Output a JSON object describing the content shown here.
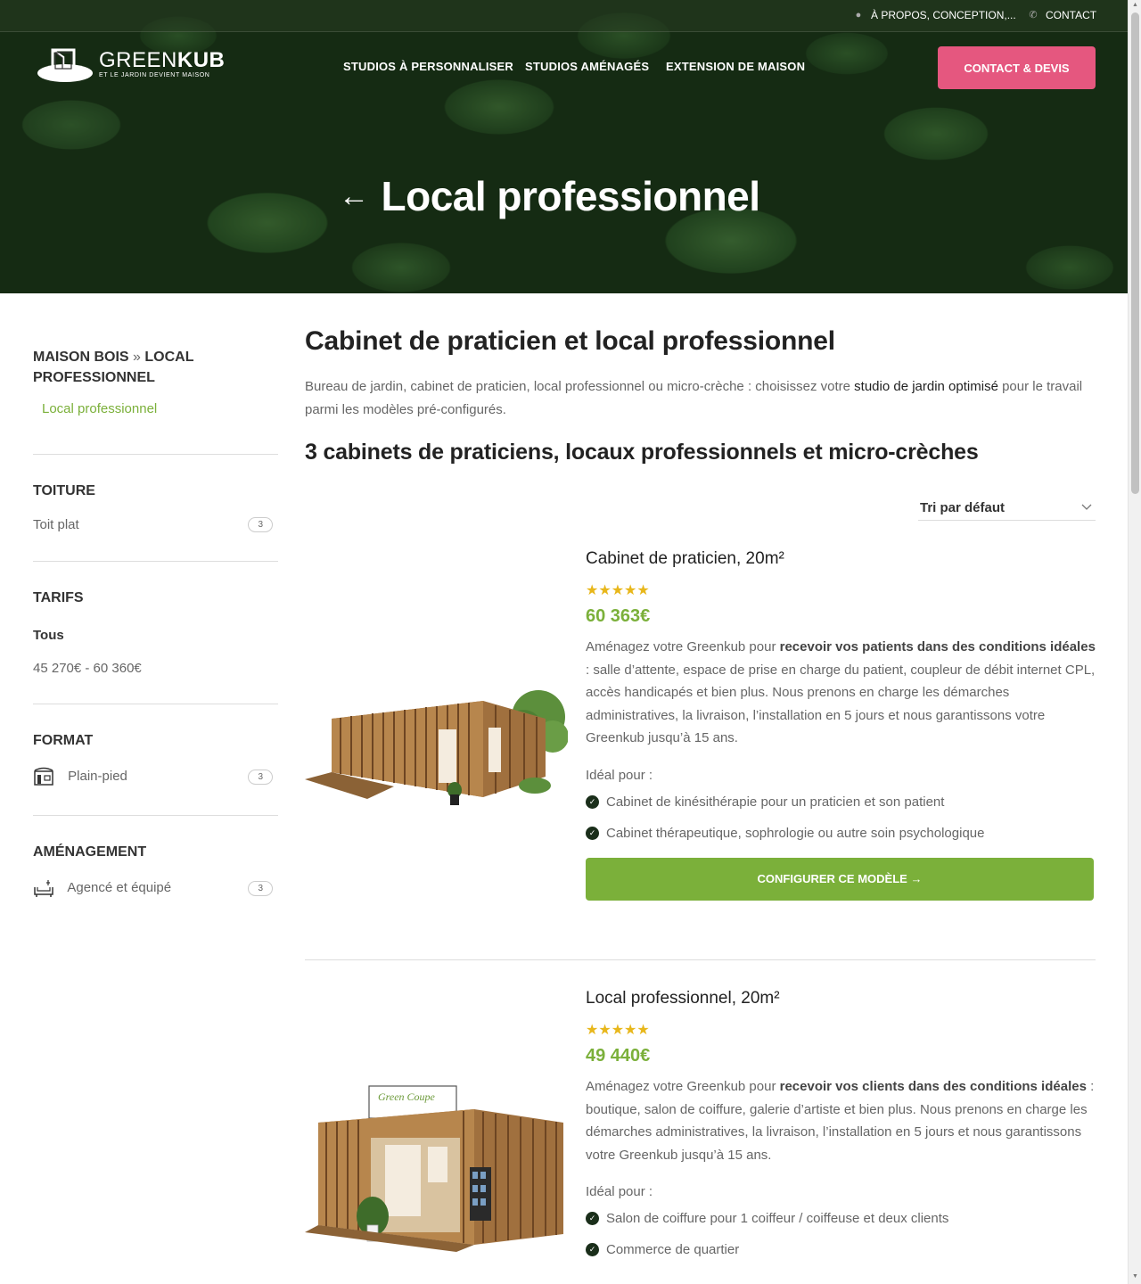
{
  "topbar": {
    "about": "À PROPOS, CONCEPTION,...",
    "contact": "CONTACT"
  },
  "logo": {
    "name_light": "GREEN",
    "name_bold": "KUB",
    "tagline": "ET LE JARDIN DEVIENT MAISON"
  },
  "nav": {
    "items": [
      "STUDIOS À PERSONNALISER",
      "STUDIOS AMÉNAGÉS",
      "EXTENSION DE MAISON"
    ],
    "cta": "CONTACT & DEVIS"
  },
  "hero": {
    "back_arrow": "←",
    "title": "Local professionnel"
  },
  "sidebar": {
    "breadcrumb": {
      "home": "MAISON BOIS",
      "sep": "»",
      "current": "LOCAL PROFESSIONNEL"
    },
    "category_link": "Local professionnel",
    "toiture": {
      "title": "TOITURE",
      "item": "Toit plat",
      "count": "3"
    },
    "tarifs": {
      "title": "TARIFS",
      "all": "Tous",
      "range": "45 270€ - 60 360€"
    },
    "format": {
      "title": "FORMAT",
      "item": "Plain-pied",
      "count": "3"
    },
    "amenagement": {
      "title": "AMÉNAGEMENT",
      "item": "Agencé et équipé",
      "count": "3"
    }
  },
  "main": {
    "title": "Cabinet de praticien et local professionnel",
    "intro_before": "Bureau de jardin, cabinet de praticien, local professionnel ou micro-crèche : choisissez votre ",
    "intro_link": "studio de jardin optimisé",
    "intro_after": " pour le travail parmi les modèles pré-configurés.",
    "subtitle": "3 cabinets de praticiens, locaux professionnels et micro-crèches",
    "sort": "Tri par défaut"
  },
  "products": [
    {
      "title": "Cabinet de praticien, 20m²",
      "stars": "★★★★★",
      "rating": 5,
      "price": "60 363€",
      "desc_before": "Aménagez votre Greenkub pour ",
      "desc_bold": "recevoir vos patients dans des conditions idéales",
      "desc_after": " : salle d’attente, espace de prise en charge du patient, coupleur de débit internet CPL, accès handicapés et bien plus. Nous prenons en charge les démarches administratives, la livraison, l’installation en 5 jours et nous garantissons votre Greenkub jusqu’à 15 ans.",
      "ideal": "Idéal pour :",
      "features": [
        "Cabinet de kinésithérapie pour un praticien et son patient",
        "Cabinet thérapeutique, sophrologie ou autre soin psychologique"
      ],
      "button": "CONFIGURER CE MODÈLE →"
    },
    {
      "title": "Local professionnel, 20m²",
      "stars": "★★★★★",
      "rating": 5,
      "price": "49 440€",
      "desc_before": "Aménagez votre Greenkub pour ",
      "desc_bold": "recevoir vos clients dans des conditions idéales",
      "desc_after": " : boutique, salon de coiffure, galerie d’artiste et bien plus. Nous prenons en charge les démarches administratives, la livraison, l’installation en 5 jours et nous garantissons votre Greenkub jusqu’à 15 ans.",
      "ideal": "Idéal pour :",
      "features": [
        "Salon de coiffure pour 1 coiffeur / coiffeuse et deux clients",
        "Commerce de quartier"
      ],
      "sign": "Green Coupe"
    }
  ],
  "colors": {
    "accent_green": "#7bb03a",
    "cta_pink": "#e5577f",
    "stars": "#e8b71b"
  }
}
